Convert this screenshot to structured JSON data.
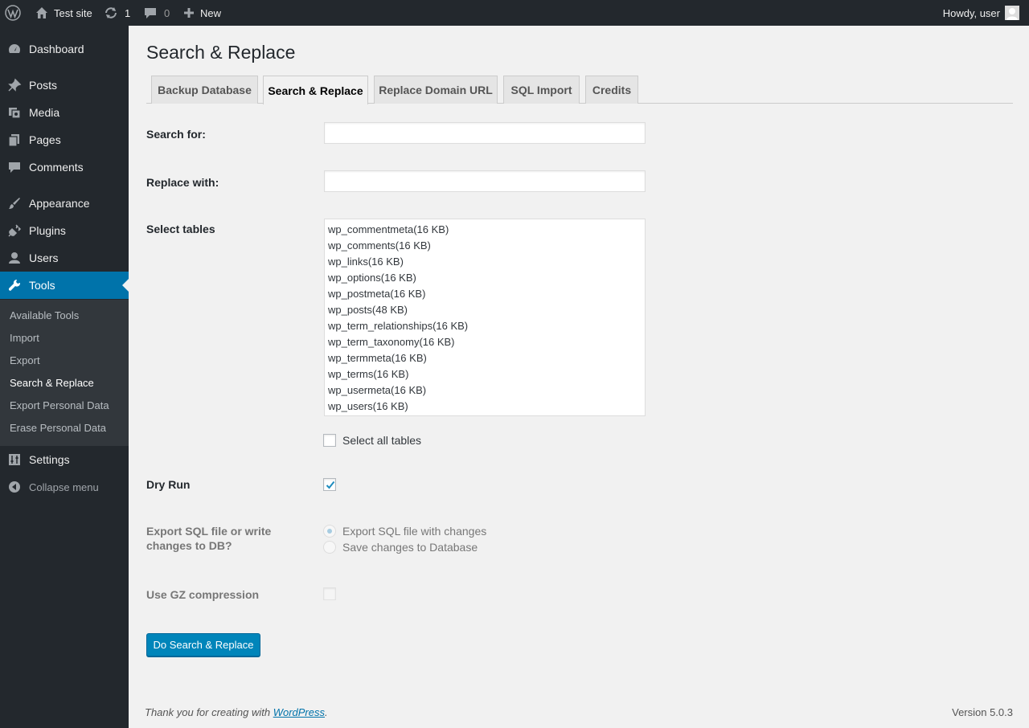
{
  "adminbar": {
    "site_name": "Test site",
    "updates_count": "1",
    "comments_count": "0",
    "new_label": "New",
    "howdy": "Howdy, user"
  },
  "menu": {
    "dashboard": "Dashboard",
    "posts": "Posts",
    "media": "Media",
    "pages": "Pages",
    "comments": "Comments",
    "appearance": "Appearance",
    "plugins": "Plugins",
    "users": "Users",
    "tools": "Tools",
    "settings": "Settings",
    "collapse": "Collapse menu",
    "submenu": [
      "Available Tools",
      "Import",
      "Export",
      "Search & Replace",
      "Export Personal Data",
      "Erase Personal Data"
    ]
  },
  "page": {
    "title": "Search & Replace",
    "tabs": [
      "Backup Database",
      "Search & Replace",
      "Replace Domain URL",
      "SQL Import",
      "Credits"
    ],
    "active_tab": "Search & Replace"
  },
  "form": {
    "search_label": "Search for:",
    "search_value": "",
    "replace_label": "Replace with:",
    "replace_value": "",
    "tables_label": "Select tables",
    "tables": [
      "wp_commentmeta(16 KB)",
      "wp_comments(16 KB)",
      "wp_links(16 KB)",
      "wp_options(16 KB)",
      "wp_postmeta(16 KB)",
      "wp_posts(48 KB)",
      "wp_term_relationships(16 KB)",
      "wp_term_taxonomy(16 KB)",
      "wp_termmeta(16 KB)",
      "wp_terms(16 KB)",
      "wp_usermeta(16 KB)",
      "wp_users(16 KB)"
    ],
    "select_all_label": "Select all tables",
    "select_all_checked": false,
    "dry_run_label": "Dry Run",
    "dry_run_checked": true,
    "export_label": "Export SQL file or write changes to DB?",
    "export_options": [
      "Export SQL file with changes",
      "Save changes to Database"
    ],
    "export_selected": "Export SQL file with changes",
    "gz_label": "Use GZ compression",
    "gz_checked": false,
    "submit_label": "Do Search & Replace"
  },
  "footer": {
    "thanks_prefix": "Thank you for creating with ",
    "thanks_link": "WordPress",
    "thanks_suffix": ".",
    "version": "Version 5.0.3"
  },
  "colors": {
    "admin_bg": "#23282d",
    "accent": "#0073aa",
    "button": "#0085ba",
    "page_bg": "#f1f1f1"
  }
}
